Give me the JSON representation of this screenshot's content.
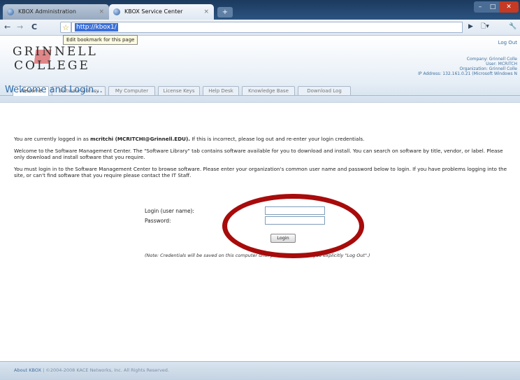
{
  "browser": {
    "tabs": [
      {
        "title": "KBOX Administration",
        "close": "×"
      },
      {
        "title": "KBOX Service Center",
        "close": "×"
      }
    ],
    "new_tab": "+",
    "window_controls": {
      "minimize": "–",
      "maximize": "□",
      "close": "✕"
    },
    "nav": {
      "back": "←",
      "forward": "→",
      "reload": "C",
      "star": "☆"
    },
    "url": "http://kbox1/",
    "tooltip": "Edit bookmark for this page",
    "right_icons": {
      "go": "▶",
      "page": "🗋▾",
      "wrench": "🔧"
    }
  },
  "banner": {
    "logo_line1": "GRINNELL",
    "logo_line2": "COLLEGE",
    "logout": "Log Out",
    "info": [
      "Company: Grinnell Colle",
      "User: MCRITCH",
      "Organization: Grinnell Colle",
      "IP Address: 132.161.0.21 (Microsoft Windows N"
    ]
  },
  "nav_tabs": [
    "Welcome",
    "Software Library",
    "My Computer",
    "License Keys",
    "Help Desk",
    "Knowledge Base",
    "Download Log"
  ],
  "page": {
    "headline": "Welcome and Login...",
    "p1_pre": "You are currently logged in as ",
    "p1_user": "mcritchi (MCRITCHI@Grinnell.EDU).",
    "p1_post": "  If this is incorrect, please log out and re-enter your login credentials.",
    "p2": "Welcome to the Software Management Center. The \"Software Library\" tab contains software available for you to download and install. You can search on software by title, vendor, or label. Please only download and install software that you require.",
    "p3": "You must login in to the Software Management Center to browse software. Please enter your organization's common user name and password below to login. If you have problems logging into the site, or can't find software that you require please contact the IT Staff.",
    "login": {
      "user_label": "Login (user name):",
      "pass_label": "Password:",
      "user_value": "",
      "pass_value": "",
      "button": "Login",
      "note": "(Note: Credentials will be saved on this computer until you log out unless you explicitly \"Log Out\".)"
    }
  },
  "footer": {
    "link": "About KBOX",
    "sep": " | ",
    "copyright": "©2004-2008 KACE Networks, Inc. All Rights Reserved."
  },
  "colors": {
    "accent": "#2d6cae",
    "annotation": "#a80b0b"
  }
}
